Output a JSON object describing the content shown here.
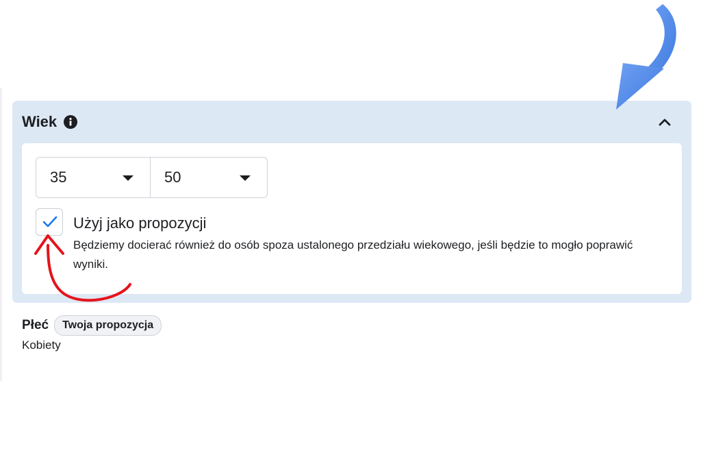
{
  "age_section": {
    "title": "Wiek",
    "min_age": "35",
    "max_age": "50",
    "suggestion_checkbox": {
      "checked": true,
      "label": "Użyj jako propozycji",
      "description": "Będziemy docierać również do osób spoza ustalonego przedziału wiekowego, jeśli będzie to mogło poprawić wyniki."
    }
  },
  "gender_section": {
    "title": "Płeć",
    "badge": "Twoja propozycja",
    "value": "Kobiety"
  },
  "next_section_clipped_title": "",
  "colors": {
    "section_background": "#dde8f5",
    "checkmark": "#1877f2",
    "annotation_blue_arrow": "#4a86e8",
    "annotation_red_arrow": "#e5141b"
  },
  "icons": [
    "info-icon",
    "chevron-up-icon",
    "caret-down-icon",
    "checkmark-icon",
    "annotation-arrow-icon"
  ]
}
